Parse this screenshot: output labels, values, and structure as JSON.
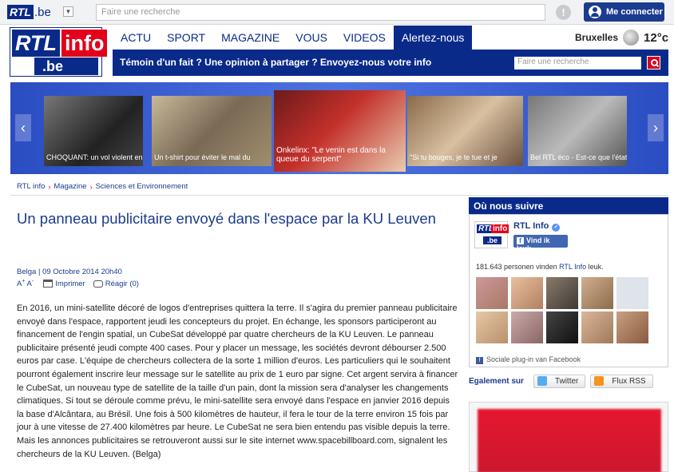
{
  "topbar": {
    "logo_rtl": "RTL",
    "logo_be": ".be",
    "search_placeholder": "Faire une recherche",
    "notif_icon": "info-icon",
    "connect_label": "Me connecter"
  },
  "header": {
    "logo_rtl": "RTL",
    "logo_info": "info",
    "logo_be": ".be",
    "nav": [
      "ACTU",
      "SPORT",
      "MAGAZINE",
      "VOUS",
      "VIDEOS",
      "Alertez-nous"
    ],
    "active_nav": "Alertez-nous",
    "weather": {
      "city": "Bruxelles",
      "temp": "12°c",
      "icon": "moon-icon"
    },
    "alert_msg": "Témoin d'un fait ? Une opinion à partager ? Envoyez-nous votre info",
    "alert_search_placeholder": "Faire une recherche"
  },
  "videos": [
    {
      "caption": "CHOQUANT: un vol violent en"
    },
    {
      "caption": "Un t-shirt pour éviter le mal du"
    },
    {
      "caption": "Onkelinx: \"Le venin est dans la queue du serpent\""
    },
    {
      "caption": "\"Si tu bouges, je te tue et je"
    },
    {
      "caption": "Bel RTL éco - Est-ce que l'état va"
    }
  ],
  "breadcrumb": [
    "RTL info",
    "Magazine",
    "Sciences et Environnement"
  ],
  "article": {
    "title": "Un panneau publicitaire envoyé dans l'espace par la KU Leuven",
    "source": "Belga",
    "date": "09 Octobre 2014 20h40",
    "font_label": "A+ A-",
    "print_label": "Imprimer",
    "react_label": "Réagir (0)",
    "body": "En 2016, un mini-satellite décoré de logos d'entreprises quittera la terre. Il s'agira du premier panneau publicitaire envoyé dans l'espace, rapportent jeudi les concepteurs du projet. En échange, les sponsors participeront au financement de l'engin spatial, un CubeSat développé par quatre chercheurs de la KU Leuven. Le panneau publicitaire présenté jeudi compte 400 cases. Pour y placer un message, les sociétés devront débourser 2.500 euros par case. L'équipe de chercheurs collectera de la sorte 1 million d'euros. Les particuliers qui le souhaitent pourront également inscrire leur message sur le satellite au prix de 1 euro par signe. Cet argent servira à financer le CubeSat, un nouveau type de satellite de la taille d'un pain, dont la mission sera d'analyser les changements climatiques. Si tout se déroule comme prévu, le mini-satellite sera envoyé dans l'espace en janvier 2016 depuis la base d'Alcântara, au Brésil. Une fois à 500 kilomètres de hauteur, il fera le tour de la terre environ 15 fois par jour à une vitesse de 27.400 kilomètres par heure. Le CubeSat ne sera bien entendu pas visible depuis la terre. Mais les annonces publicitaires se retrouveront aussi sur le site internet www.spacebillboard.com, signalent les chercheurs de la KU Leuven. (Belga)"
  },
  "sidebar": {
    "title": "Où nous suivre",
    "fb_name": "RTL Info",
    "fb_like": "Vind ik leuk",
    "fb_count_pre": "181.643 personen vinden ",
    "fb_count_link": "RTL Info",
    "fb_count_post": " leuk.",
    "fb_plugin": "Sociale plug-in van Facebook",
    "share_label": "Egalement sur",
    "twitter_label": "Twitter",
    "rss_label": "Flux RSS"
  },
  "colors": {
    "brand_blue": "#0a2a8a",
    "brand_red": "#e2001a",
    "link_blue": "#1b3b8f",
    "facebook_blue": "#4267b2"
  }
}
